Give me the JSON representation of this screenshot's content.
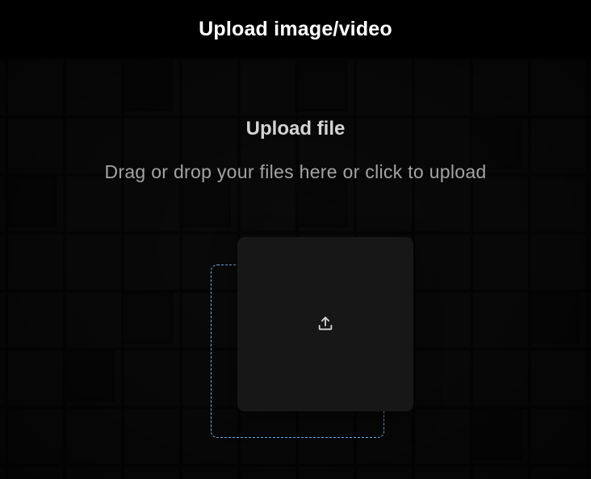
{
  "header": {
    "title": "Upload image/video"
  },
  "dropzone": {
    "heading": "Upload file",
    "hint": "Drag or drop your files here or click to upload",
    "icon": "upload-icon"
  },
  "colors": {
    "background": "#000000",
    "card": "#171717",
    "dashed_accent": "#6fb3e8",
    "title_text": "#ffffff",
    "heading_text": "#d4d4d4",
    "hint_text": "#a3a3a3"
  }
}
